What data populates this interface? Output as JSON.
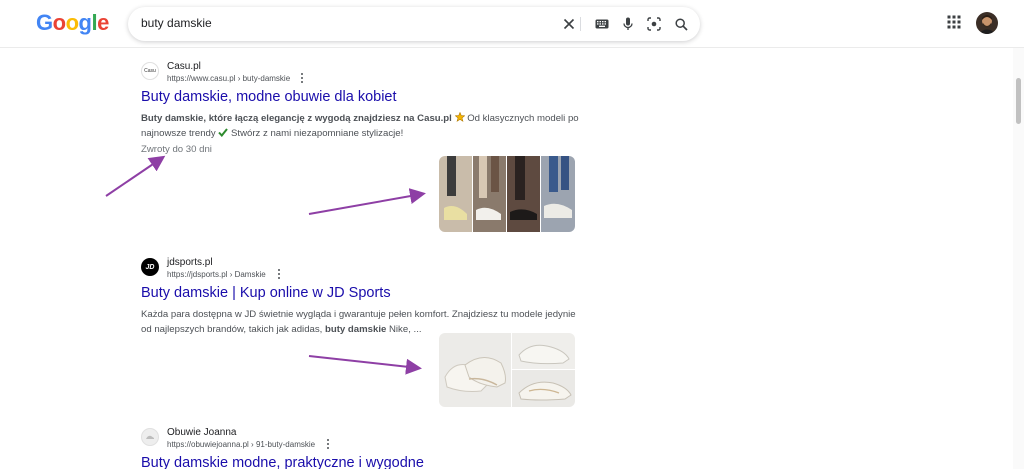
{
  "header": {
    "logo_text": "Google",
    "logo_colors": [
      "#4285F4",
      "#EA4335",
      "#FBBC05",
      "#4285F4",
      "#34A853",
      "#EA4335"
    ],
    "search_value": "buty damskie",
    "icons": [
      "clear-icon",
      "keyboard-icon",
      "microphone-icon",
      "lens-icon",
      "search-icon",
      "apps-icon"
    ]
  },
  "results": [
    {
      "site_name": "Casu.pl",
      "url": "https://www.casu.pl › buty-damskie",
      "title": "Buty damskie, modne obuwie dla kobiet",
      "snippet_bold": "Buty damskie, które łączą elegancję z wygodą znajdziesz na Casu.pl",
      "snippet_rest": "Od klasycznych modeli po najnowsze trendy",
      "snippet_end": "Stwórz z nami niezapomniane stylizacje!",
      "meta": "Zwroty do 30 dni"
    },
    {
      "site_name": "jdsports.pl",
      "url": "https://jdsports.pl › Damskie",
      "title": "Buty damskie | Kup online w JD Sports",
      "snippet_start": "Każda para dostępna w JD świetnie wygląda i gwarantuje pełen komfort. Znajdziesz tu modele jedynie od najlepszych brandów, takich jak adidas,",
      "snippet_bold": "buty damskie",
      "snippet_end": "Nike, ..."
    },
    {
      "site_name": "Obuwie Joanna",
      "url": "https://obuwiejoanna.pl › 91-buty-damskie",
      "title": "Buty damskie modne, praktyczne i wygodne"
    }
  ],
  "colors": {
    "link": "#1a0dab",
    "annotation_arrow": "#8e3fa5",
    "favicon_jd": "#000000"
  }
}
